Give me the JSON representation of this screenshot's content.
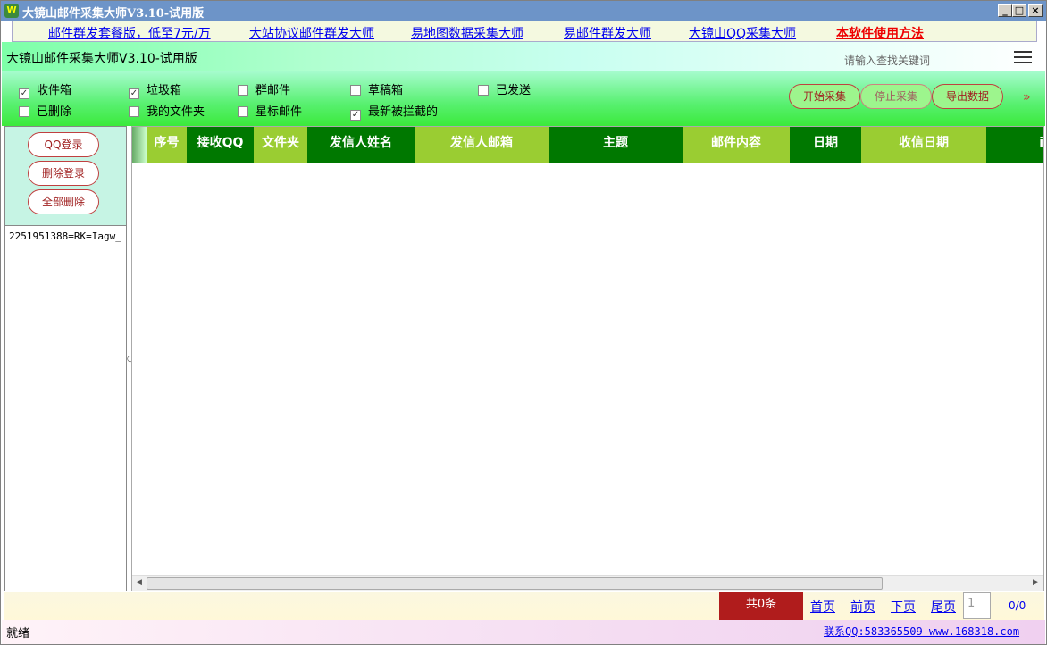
{
  "window": {
    "title": "大镜山邮件采集大师V3.10-试用版",
    "icon": "app-logo-icon"
  },
  "links": [
    {
      "label": "邮件群发套餐版，低至7元/万",
      "highlight": false
    },
    {
      "label": "大站协议邮件群发大师",
      "highlight": false
    },
    {
      "label": "易地图数据采集大师",
      "highlight": false
    },
    {
      "label": "易邮件群发大师",
      "highlight": false
    },
    {
      "label": "大镜山QQ采集大师",
      "highlight": false
    },
    {
      "label": "本软件使用方法",
      "highlight": true
    }
  ],
  "header": {
    "app_title": "大镜山邮件采集大师V3.10-试用版",
    "search_placeholder": "请输入查找关键词",
    "menu_icon": "hamburger-menu-icon"
  },
  "folders": [
    {
      "label": "收件箱",
      "checked": true
    },
    {
      "label": "垃圾箱",
      "checked": true
    },
    {
      "label": "群邮件",
      "checked": false
    },
    {
      "label": "草稿箱",
      "checked": false
    },
    {
      "label": "已发送",
      "checked": false
    },
    {
      "label": "已删除",
      "checked": false
    },
    {
      "label": "我的文件夹",
      "checked": false
    },
    {
      "label": "星标邮件",
      "checked": false
    },
    {
      "label": "最新被拦截的",
      "checked": true
    }
  ],
  "actions": {
    "start": "开始采集",
    "stop": "停止采集",
    "export": "导出数据",
    "more": "»"
  },
  "left": {
    "qq_login": "QQ登录",
    "delete_login": "删除登录",
    "delete_all": "全部删除",
    "account": "2251951388=RK=Iagw_"
  },
  "table": {
    "columns": [
      "序号",
      "接收QQ",
      "文件夹",
      "发信人姓名",
      "发信人邮箱",
      "主题",
      "邮件内容",
      "日期",
      "收信日期",
      "i"
    ],
    "rows": []
  },
  "footer": {
    "count": "共0条",
    "first": "首页",
    "prev": "前页",
    "next": "下页",
    "last": "尾页",
    "page": "1",
    "total": "0/0"
  },
  "status": {
    "text": "就绪",
    "contact": "联系QQ:583365509 www.168318.com"
  },
  "colors": {
    "title_bar": "#6d94c8",
    "header_green": "#3bea3b",
    "col_light": "#9acd32",
    "col_dark": "#007800",
    "count_bg": "#b01c1c"
  }
}
